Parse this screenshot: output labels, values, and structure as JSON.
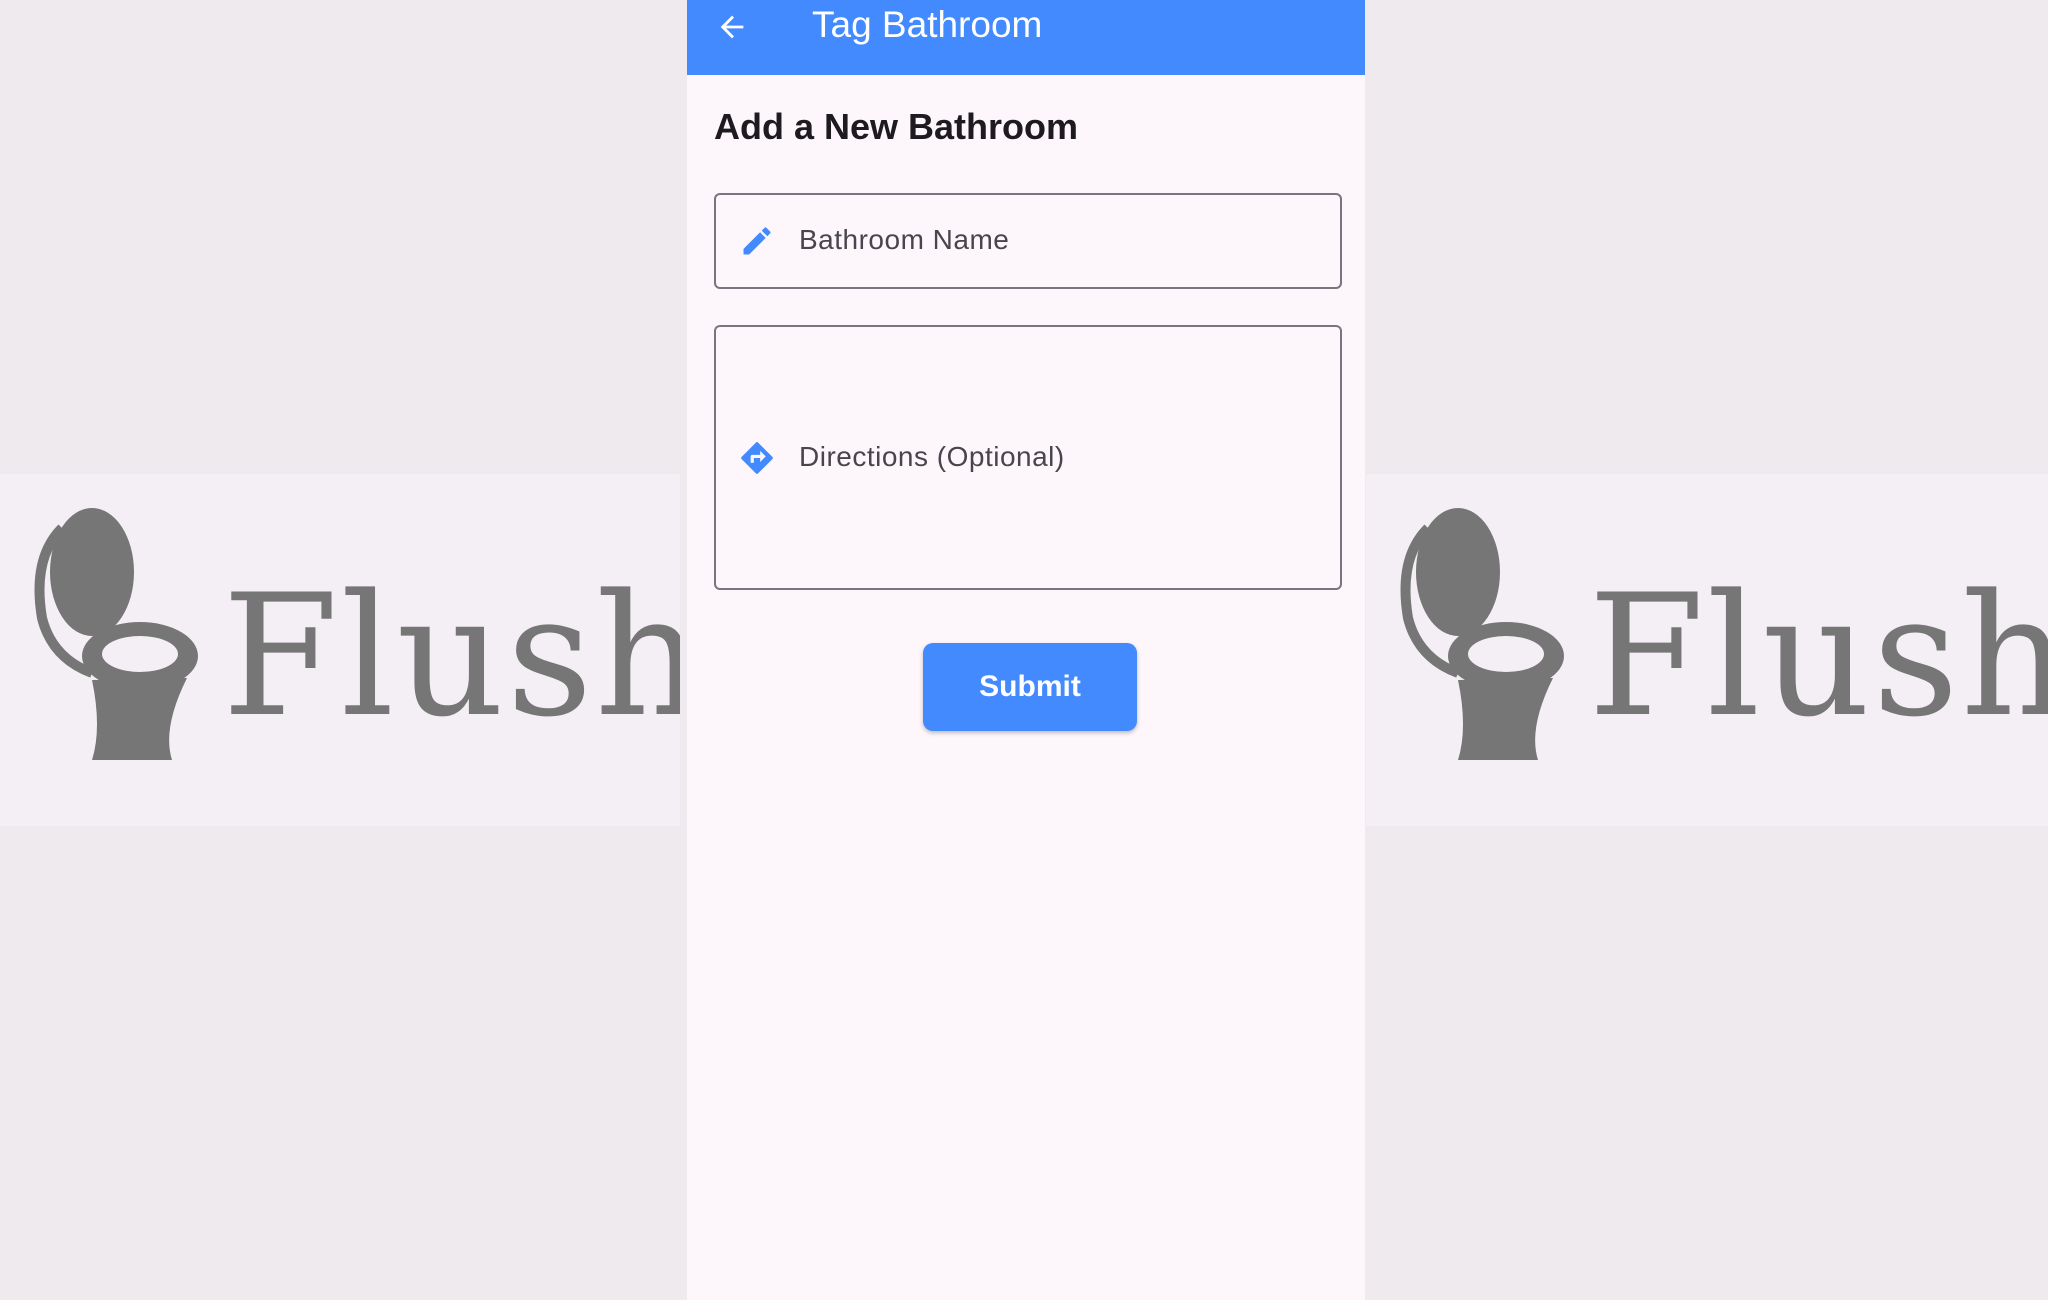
{
  "app": {
    "brand_name": "Flush"
  },
  "appbar": {
    "back_icon": "arrow-left-icon",
    "title": "Tag Bathroom"
  },
  "form": {
    "heading": "Add a New Bathroom",
    "name_field": {
      "icon": "pencil-icon",
      "placeholder": "Bathroom Name",
      "value": ""
    },
    "directions_field": {
      "icon": "directions-icon",
      "placeholder": "Directions (Optional)",
      "value": ""
    },
    "submit_label": "Submit"
  },
  "colors": {
    "primary": "#448aff",
    "page_background": "#fdf7fc",
    "outside_background": "#eeeaee",
    "logo_gray": "#767676"
  }
}
